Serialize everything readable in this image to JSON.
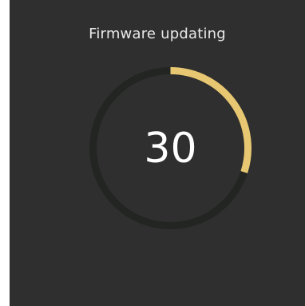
{
  "dialog": {
    "title": "Firmware updating",
    "progress_value": "30",
    "progress_fraction": 0.3
  },
  "colors": {
    "background": "#2f2f2f",
    "track": "#222522",
    "progress": "#e7c771",
    "text": "#ffffff"
  }
}
